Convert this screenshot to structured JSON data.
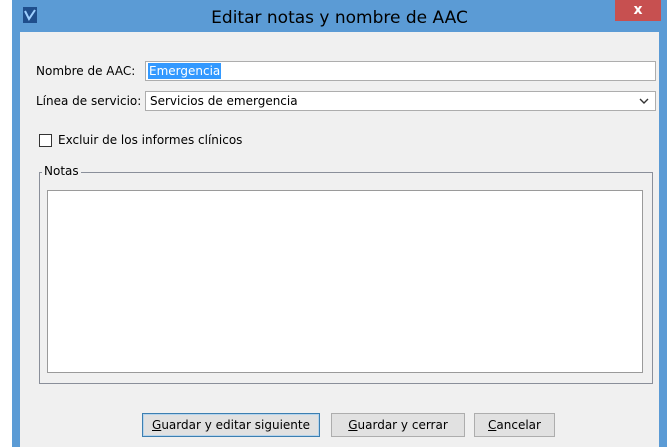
{
  "window": {
    "title": "Editar notas y nombre de AAC",
    "app_icon": "app-icon",
    "close_label": "x"
  },
  "form": {
    "name_label": "Nombre de AAC:",
    "name_value": "Emergencia",
    "service_label": "Línea de servicio:",
    "service_value": "Servicios de emergencia",
    "exclude_label": "Excluir de los informes clínicos",
    "exclude_checked": false,
    "notes_legend": "Notas",
    "notes_value": ""
  },
  "buttons": {
    "save_next_first": "G",
    "save_next_rest": "uardar y editar siguiente",
    "save_close_first": "G",
    "save_close_rest": "uardar y cerrar",
    "cancel_first": "C",
    "cancel_rest": "ancelar"
  },
  "colors": {
    "titlebar": "#5b9bd5",
    "close": "#c75050",
    "selection": "#3399ff",
    "dialog_bg": "#f0f0f0"
  }
}
